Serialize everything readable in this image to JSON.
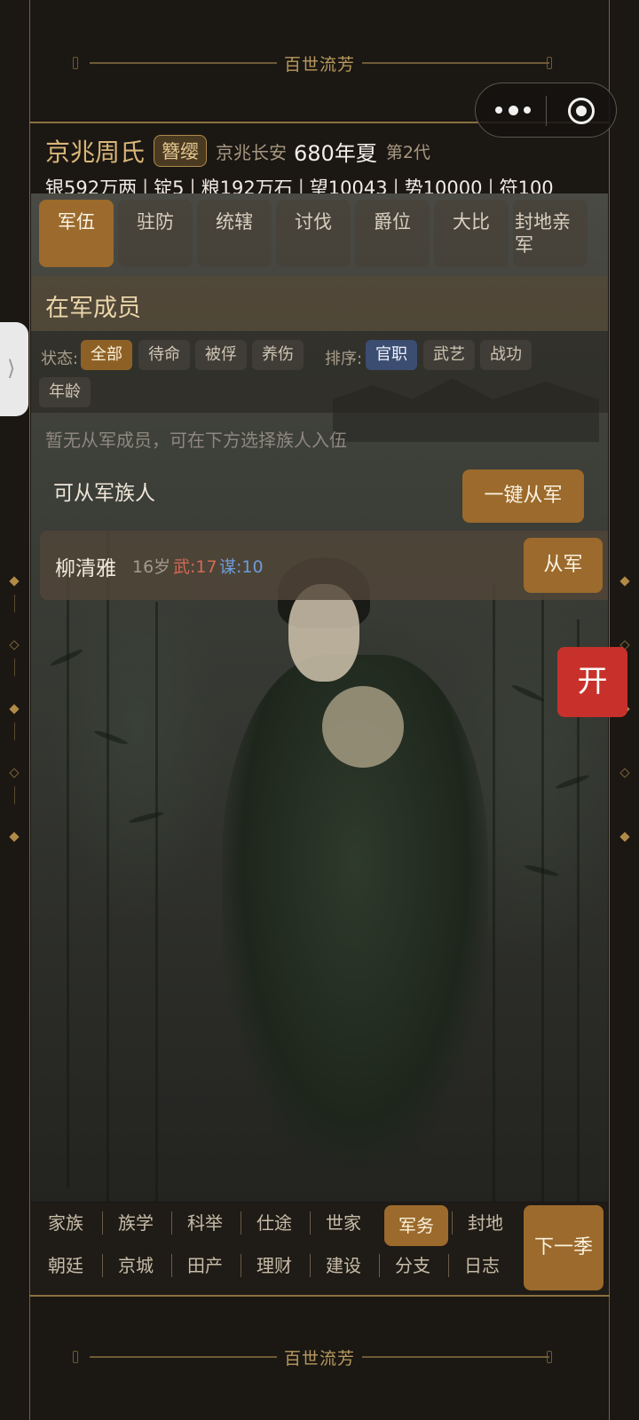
{
  "banner": {
    "title": "百世流芳"
  },
  "header": {
    "clan_name": "京兆周氏",
    "rank_badge": "簪缨",
    "seat": "京兆长安",
    "year": "680年夏",
    "generation": "第2代",
    "resources": [
      "银592万两",
      "锭5",
      "粮192万石",
      "望10043",
      "势10000",
      "符100"
    ]
  },
  "tabs": [
    "军伍",
    "驻防",
    "统辖",
    "讨伐",
    "爵位",
    "大比",
    "封地亲军"
  ],
  "active_tab": "军伍",
  "section_title": "在军成员",
  "filters": {
    "status_label": "状态:",
    "status_options": [
      "全部",
      "待命",
      "被俘",
      "养伤"
    ],
    "status_selected": "全部",
    "sort_label": "排序:",
    "sort_options": [
      "官职",
      "武艺",
      "战功",
      "年龄"
    ],
    "sort_selected": "官职"
  },
  "empty_note": "暂无从军成员，可在下方选择族人入伍",
  "available": {
    "label": "可从军族人",
    "enlist_all_button": "一键从军",
    "members": [
      {
        "name": "柳清雅",
        "age": "16岁",
        "wu": "武:17",
        "mou": "谋:10",
        "action": "从军"
      }
    ]
  },
  "nav": {
    "row1": [
      "家族",
      "族学",
      "科举",
      "仕途",
      "世家",
      "军务",
      "封地"
    ],
    "row2": [
      "朝廷",
      "京城",
      "田产",
      "理财",
      "建设",
      "分支",
      "日志"
    ],
    "active": "军务",
    "next_season": "下一季"
  },
  "side_tab": {
    "glyph": "⟩"
  },
  "open_button": "开",
  "colors": {
    "accent_gold": "#9b6a2c",
    "accent_blue": "#3c4d72",
    "danger_red": "#c8312b",
    "title_gold": "#d9b677"
  }
}
